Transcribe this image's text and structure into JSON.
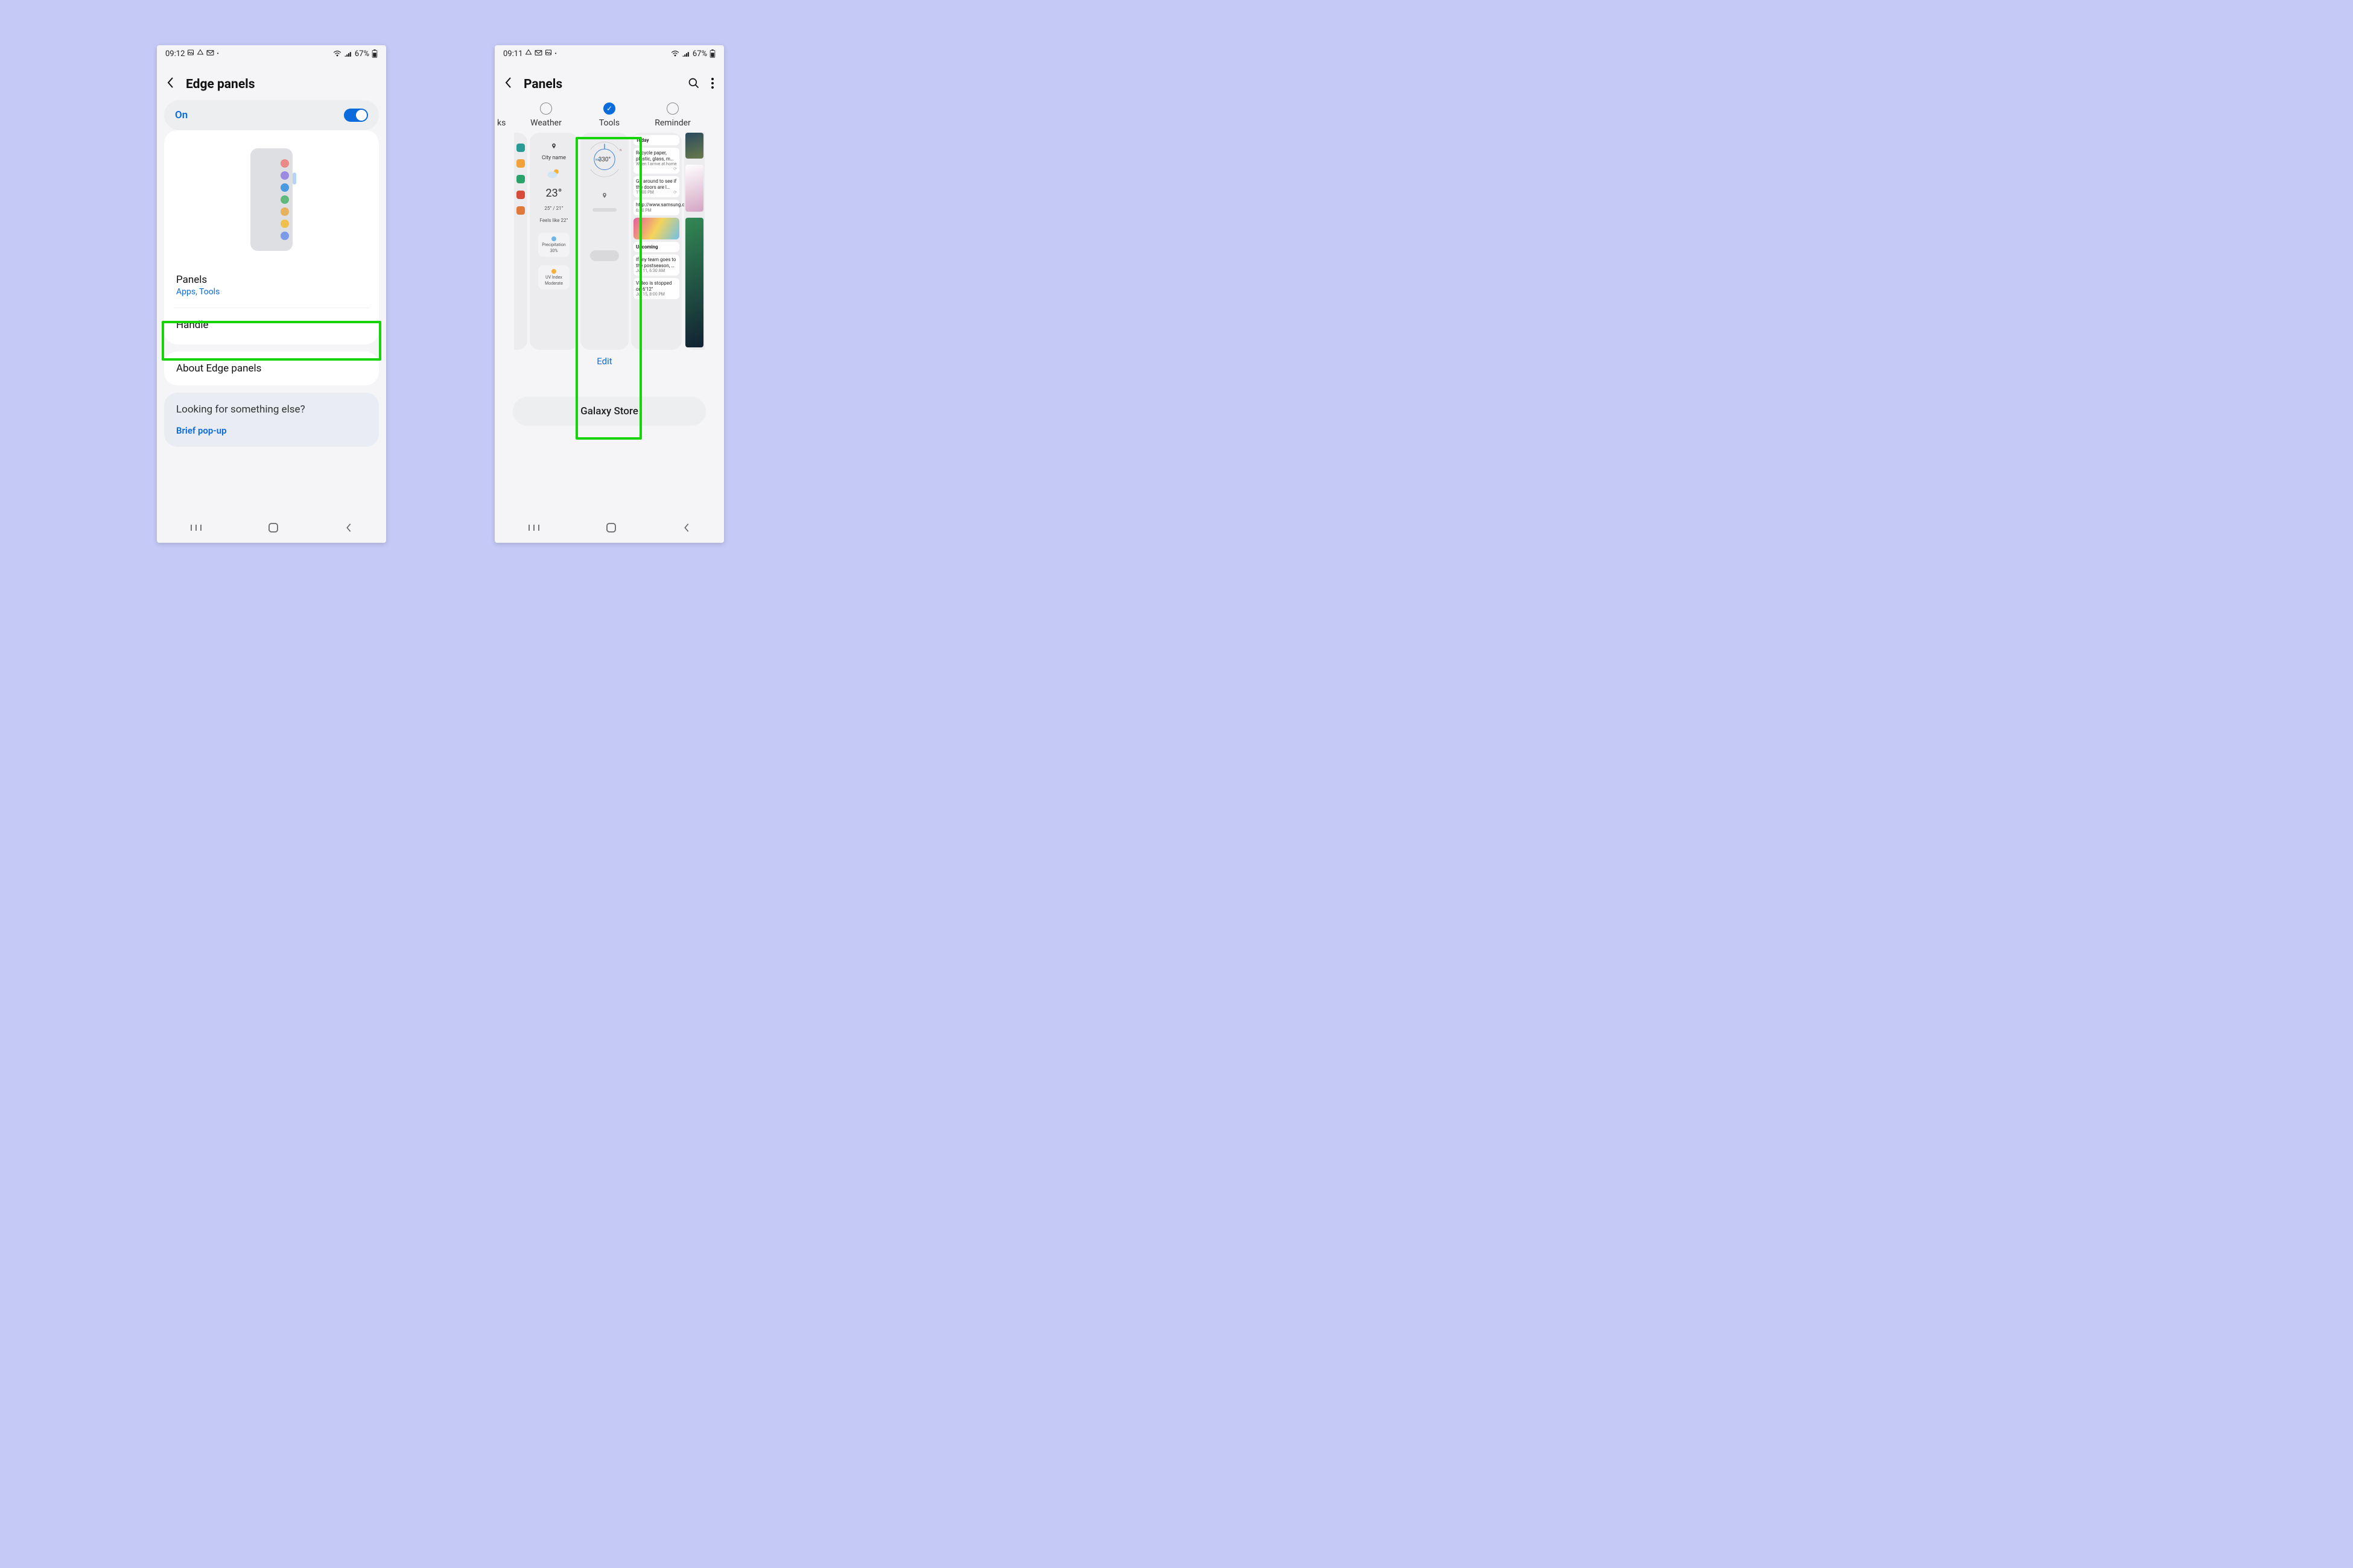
{
  "left": {
    "status": {
      "time": "09:12",
      "battery": "67%"
    },
    "title": "Edge panels",
    "toggle_label": "On",
    "panels": {
      "title": "Panels",
      "subtitle": "Apps, Tools"
    },
    "handle": "Handle",
    "about": "About Edge panels",
    "hint_q": "Looking for something else?",
    "hint_link": "Brief pop-up"
  },
  "right": {
    "status": {
      "time": "09:11",
      "battery": "67%"
    },
    "title": "Panels",
    "tabs": {
      "edge_left_label": "ks",
      "weather": "Weather",
      "tools": "Tools",
      "reminder": "Reminder"
    },
    "weather": {
      "city": "City name",
      "temp": "23°",
      "hilo": "25° / 21°",
      "feels": "Feels like 22°",
      "precip_label": "Precipitation",
      "precip_value": "30%",
      "uv_label": "UV Index",
      "uv_value": "Moderate"
    },
    "tools": {
      "dir": "NW",
      "deg": "330°"
    },
    "reminder": {
      "today": "Today",
      "r1_title": "Recycle paper, plastic, glass, m…",
      "r1_meta": "When I arrive at home",
      "r2_title": "Go around to see if the doors are l…",
      "r2_meta": "11:00 PM",
      "r3_title": "http://www.samsung.com",
      "r3_meta": "6:00 PM",
      "upcoming": "Upcoming",
      "r4_title": "If my team goes to the postseason, …",
      "r4_meta": "Jul 11, 6:30 AM",
      "r5_title": "Video is stopped on 6'12\"",
      "r5_meta": "Jul 15, 8:00 PM"
    },
    "edit": "Edit",
    "store": "Galaxy Store"
  }
}
